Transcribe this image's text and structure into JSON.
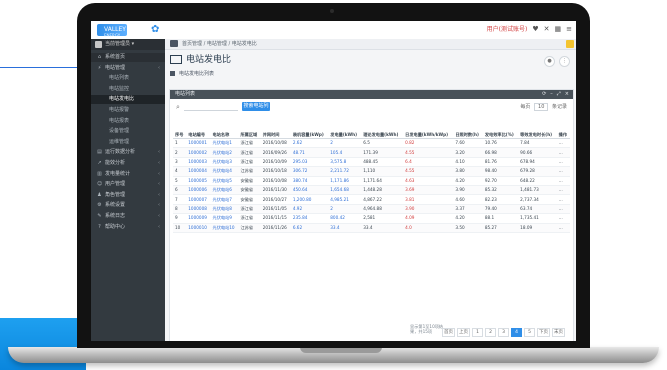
{
  "topbar": {
    "logo_text": "VALLEY",
    "logo_sub": "ENERGY",
    "user_label": "用户(测试账号)",
    "icons": [
      "heart-icon",
      "close-icon",
      "grid-icon",
      "menu-icon"
    ]
  },
  "sidebar": {
    "profile_name": "当前管理员 ▾",
    "items": [
      {
        "label": "系统首页",
        "icon": "home-icon",
        "type": "section",
        "active": false
      },
      {
        "label": "电站管理",
        "icon": "bolt-icon",
        "type": "parent",
        "active": false
      },
      {
        "label": "电站列表",
        "type": "sub",
        "active": false
      },
      {
        "label": "电站监控",
        "type": "sub",
        "active": false
      },
      {
        "label": "电站发电比",
        "type": "sub",
        "active": true
      },
      {
        "label": "电站报警",
        "type": "sub",
        "active": false
      },
      {
        "label": "电站报表",
        "type": "sub",
        "active": false
      },
      {
        "label": "设备管理",
        "type": "sub",
        "active": false
      },
      {
        "label": "运维管理",
        "type": "sub",
        "active": false
      },
      {
        "label": "运行数据分析",
        "icon": "chart-icon",
        "type": "parent",
        "active": false
      },
      {
        "label": "能效分析",
        "icon": "line-icon",
        "type": "parent",
        "active": false
      },
      {
        "label": "发电量统计",
        "icon": "stat-icon",
        "type": "parent",
        "active": false
      },
      {
        "label": "用户管理",
        "icon": "user-icon",
        "type": "parent",
        "active": false
      },
      {
        "label": "角色管理",
        "icon": "role-icon",
        "type": "parent",
        "active": false
      },
      {
        "label": "系统设置",
        "icon": "gear-icon",
        "type": "parent",
        "active": false
      },
      {
        "label": "系统日志",
        "icon": "log-icon",
        "type": "parent",
        "active": false
      },
      {
        "label": "帮助中心",
        "icon": "help-icon",
        "type": "parent",
        "active": false
      }
    ]
  },
  "breadcrumb": "首页管理 / 电站管理 / 电站发电比",
  "page": {
    "title": "电站发电比",
    "subtab": "电站发电比列表",
    "panel_title": "电站列表",
    "panel_ctrls": [
      "⟳",
      "–",
      "⤢",
      "×"
    ],
    "search_placeholder": "",
    "search_button": "搜索电站列表",
    "page_size_label": "每页",
    "page_size_value": "10",
    "page_size_suffix": "条记录"
  },
  "table": {
    "headers": [
      "序号",
      "电站编号",
      "电站名称",
      "所属区域",
      "并网时间",
      "装机容量(kWp)",
      "发电量(kWh)",
      "理论发电量(kWh)",
      "日发电量(kWh/kWp)",
      "日照时数(h)",
      "发电效率比(%)",
      "等效发电时长(h)",
      "操作"
    ],
    "rows": [
      [
        "1",
        "1000001",
        "光伏电站1",
        "浙江省",
        "2016/10/08",
        "2.62",
        "2",
        "6.5",
        "0.82",
        "7.60",
        "10.76",
        "7.84",
        "…"
      ],
      [
        "2",
        "1000002",
        "光伏电站2",
        "浙江省",
        "2016/09/26",
        "48.71",
        "105.4",
        "171.39",
        "4.55",
        "3.20",
        "66.98",
        "90.66",
        "…"
      ],
      [
        "3",
        "1000003",
        "光伏电站3",
        "浙江省",
        "2016/10/09",
        "295.03",
        "3,575.8",
        "488.45",
        "6.4",
        "4.10",
        "81.76",
        "678.94",
        "…"
      ],
      [
        "4",
        "1000004",
        "光伏电站4",
        "江苏省",
        "2016/10/18",
        "306.72",
        "2,211.72",
        "1,110",
        "4.55",
        "3.80",
        "98.40",
        "679.28",
        "…"
      ],
      [
        "5",
        "1000005",
        "光伏电站5",
        "安徽省",
        "2016/10/08",
        "380.74",
        "1,171.86",
        "1,171.64",
        "4.63",
        "4.20",
        "92.70",
        "648.22",
        "…"
      ],
      [
        "6",
        "1000006",
        "光伏电站6",
        "安徽省",
        "2016/11/30",
        "450.64",
        "1,654.68",
        "1,448.28",
        "3.69",
        "3.90",
        "85.32",
        "1,481.73",
        "…"
      ],
      [
        "7",
        "1000007",
        "光伏电站7",
        "安徽省",
        "2016/10/27",
        "1,200.80",
        "4,985.21",
        "4,867.22",
        "3.81",
        "4.60",
        "82.23",
        "2,737.34",
        "…"
      ],
      [
        "8",
        "1000008",
        "光伏电站8",
        "浙江省",
        "2016/11/05",
        "4.92",
        "2",
        "4,964.88",
        "3.90",
        "3.37",
        "79.40",
        "63.74",
        "…"
      ],
      [
        "9",
        "1000009",
        "光伏电站9",
        "浙江省",
        "2016/11/15",
        "235.84",
        "800.42",
        "2,581",
        "4.09",
        "4.20",
        "88.1",
        "1,735.41",
        "…"
      ],
      [
        "10",
        "1000010",
        "光伏电站10",
        "江苏省",
        "2016/11/26",
        "6.62",
        "33.4",
        "33.4",
        "4.0",
        "3.50",
        "85.27",
        "18.09",
        "…"
      ]
    ]
  },
  "pager": {
    "info": "显示第1至10项结果，共15项",
    "first": "首页",
    "prev": "上页",
    "pages": [
      "1",
      "2",
      "3",
      "4",
      "5"
    ],
    "active_page": "4",
    "next": "下页",
    "last": "末页"
  },
  "colors": {
    "accent": "#2f8ee8",
    "sidebar": "#333a40",
    "panel_head": "#485159",
    "warn": "#d23c3c"
  }
}
